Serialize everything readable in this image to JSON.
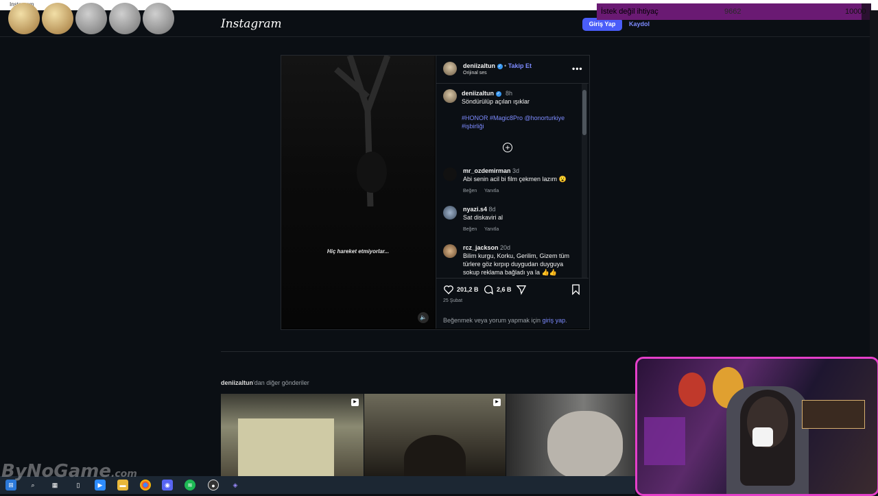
{
  "window": {
    "title": "Instagram"
  },
  "header": {
    "logo": "Instagram",
    "login_label": "Giriş Yap",
    "signup_label": "Kaydol"
  },
  "goal_overlay": {
    "label": "İstek değil ihtiyaç",
    "current": "9662",
    "target": "10000",
    "progress": 0.9662,
    "color": "#6a1a73"
  },
  "post": {
    "author": "deniizaltun",
    "follow_label": "Takip Et",
    "audio": "Orijinal ses",
    "video_caption": "Hiç hareket etmiyorlar...",
    "caption": {
      "time": "8h",
      "text": "Söndürülüp açılan ışıklar",
      "tags_line1": "#HONOR #Magic8Pro @honorturkiye",
      "tags_line2": "#işbirliği"
    },
    "comments": [
      {
        "user": "mr_ozdemirman",
        "time": "3d",
        "text": "Abi senin acil bi film çekmen lazım 😮",
        "like": "Beğen",
        "reply": "Yanıtla"
      },
      {
        "user": "nyazi.s4",
        "time": "8d",
        "text": "Sat diskaviri al",
        "like": "Beğen",
        "reply": "Yanıtla"
      },
      {
        "user": "rcz_jackson",
        "time": "20d",
        "text_line1": "Bilim kurgu, Korku, Gerilim, Gizem tüm",
        "text_line2": "türlere göz kırpıp duygudan duyguya",
        "text_line3": "sokup reklama bağladı ya la 👍👍"
      }
    ],
    "likes": "201,2 B",
    "comments_count": "2,6 B",
    "date": "25 Şubat",
    "login_prompt_prefix": "Beğenmek veya yorum yapmak için ",
    "login_prompt_link": "giriş yap",
    "login_prompt_suffix": "."
  },
  "more_posts": {
    "user": "deniizaltun",
    "suffix": "'dan diğer gönderiler"
  },
  "watermark": "ByNoGame",
  "watermark_suffix": ".com"
}
